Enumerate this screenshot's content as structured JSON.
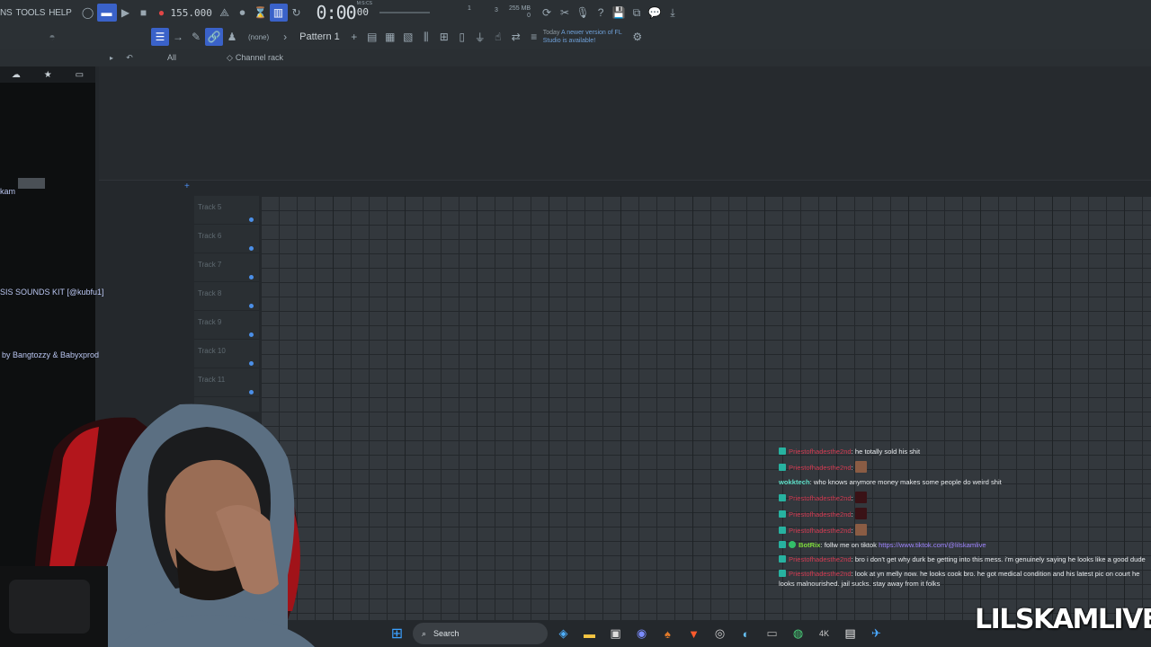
{
  "menu": {
    "items": [
      "NS",
      "TOOLS",
      "HELP"
    ]
  },
  "transport": {
    "tempo": "155.000",
    "time": "0:00",
    "time_frac": "00",
    "time_unit": "M:S:CS",
    "memory": "255 MB",
    "memory_sub": "0",
    "poly": "3",
    "pos_marker": "1"
  },
  "toolbar2": {
    "pattern_selector": "(none)",
    "pattern_name": "Pattern 1",
    "news_date": "Today",
    "news_text": "A newer version of FL Studio is available!"
  },
  "browser": {
    "filter": "All",
    "channel_rack_label": "Channel rack",
    "items": [
      {
        "label": "kam"
      },
      {
        "label": "SIS SOUNDS KIT [@kubfu1]"
      },
      {
        "label": "by Bangtozzy & Babyxprod"
      }
    ]
  },
  "playlist": {
    "tracks": [
      "Track 5",
      "Track 6",
      "Track 7",
      "Track 8",
      "Track 9",
      "Track 10",
      "Track 11"
    ]
  },
  "chat": {
    "messages": [
      {
        "user": "Priestofhadesthe2nd",
        "style": "red",
        "text": ": he totally sold his shit",
        "emote": ""
      },
      {
        "user": "Priestofhadesthe2nd",
        "style": "red",
        "text": ":",
        "emote": "face"
      },
      {
        "user": "wokktech",
        "style": "teal",
        "text": ": who knows anymore money makes some people do weird shit",
        "emote": ""
      },
      {
        "user": "Priestofhadesthe2nd",
        "style": "red",
        "text": ":",
        "emote": "dark"
      },
      {
        "user": "Priestofhadesthe2nd",
        "style": "red",
        "text": ":",
        "emote": "dark"
      },
      {
        "user": "Priestofhadesthe2nd",
        "style": "red",
        "text": ":",
        "emote": "face"
      },
      {
        "user": "BotRix",
        "style": "bot",
        "text": ": follw me on tiktok",
        "link": "https://www.tiktok.com/@lilskamlive",
        "emote": ""
      },
      {
        "user": "Priestofhadesthe2nd",
        "style": "red",
        "text": ": bro i don't get why durk be getting into this mess. i'm genuinely saying he looks like a good dude",
        "emote": ""
      },
      {
        "user": "Priestofhadesthe2nd",
        "style": "red",
        "text": ": look at yn melly now. he looks cook bro. he got medical condition and his latest pic on court he looks malnourished. jail sucks. stay away from it folks",
        "emote": ""
      }
    ]
  },
  "taskbar": {
    "search_label": "Search"
  },
  "watermark": "LILSKAMLIVE",
  "colors": {
    "accent": "#3a62c9",
    "record": "#e14646",
    "chat_red": "#d23b52",
    "chat_teal": "#5fe0c9",
    "bot_green": "#7fdd3d",
    "link": "#9f84ff"
  }
}
